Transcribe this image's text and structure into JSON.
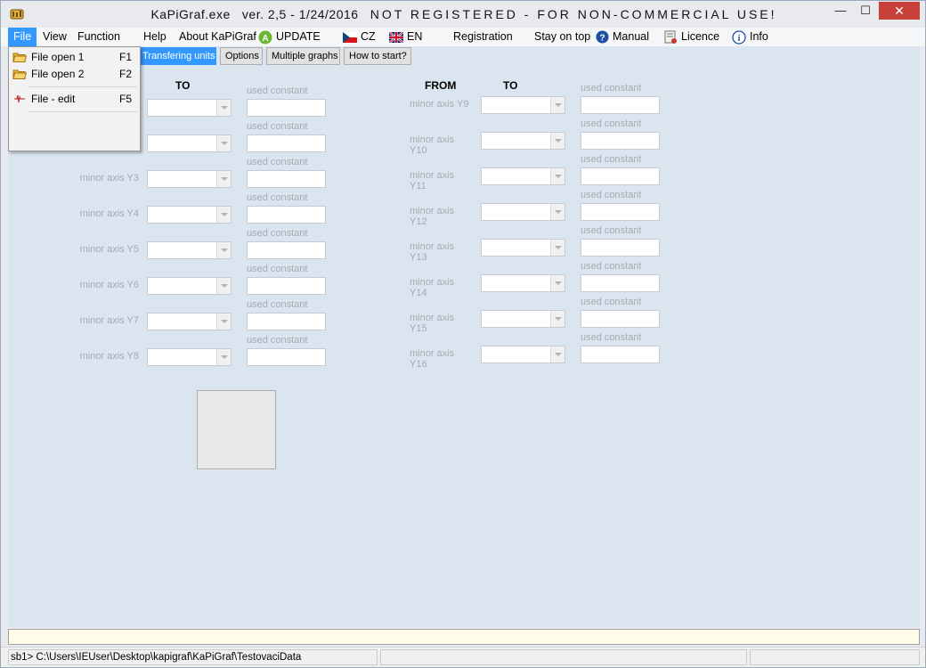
{
  "window": {
    "title_main": "KaPiGraf.exe",
    "title_version": "ver. 2,5  - 1/24/2016",
    "title_notice": "NOT REGISTERED - FOR NON-COMMERCIAL USE!",
    "min_glyph": "—",
    "max_glyph": "☐",
    "close_glyph": "✕"
  },
  "menubar": {
    "file": "File",
    "view": "View",
    "function": "Function",
    "help": "Help",
    "about": "About KaPiGraf",
    "update": "UPDATE",
    "cz": "CZ",
    "en": "EN",
    "registration": "Registration",
    "stay_on_top": "Stay on top",
    "manual": "Manual",
    "licence": "Licence",
    "info": "Info"
  },
  "file_menu": {
    "items": [
      {
        "label": "File open 1",
        "key": "F1",
        "icon": "folder-open-icon"
      },
      {
        "label": "File open 2",
        "key": "F2",
        "icon": "folder-open-icon"
      },
      {
        "label": "File - edit",
        "key": "F5",
        "icon": "edit-graph-icon"
      }
    ]
  },
  "tabs": {
    "transfering": "Transfering units",
    "options": "Options",
    "multiple": "Multiple graphs",
    "how_to_start": "How to start?"
  },
  "columns": {
    "left_to": "TO",
    "right_from": "FROM",
    "right_to": "TO",
    "used_constant": "used constant"
  },
  "left_rows": [
    "",
    "",
    "minor axis Y3",
    "minor axis Y4",
    "minor axis Y5",
    "minor axis Y6",
    "minor axis Y7",
    "minor axis Y8"
  ],
  "right_rows": [
    "minor axis Y9",
    "minor axis Y10",
    "minor axis Y11",
    "minor axis Y12",
    "minor axis Y13",
    "minor axis Y14",
    "minor axis Y15",
    "minor axis Y16"
  ],
  "status": {
    "path": "sb1> C:\\Users\\IEUser\\Desktop\\kapigraf\\KaPiGraf\\TestovaciData"
  },
  "colors": {
    "accent": "#3399ff",
    "panel": "#dbe5f0",
    "close": "#c7403a"
  }
}
